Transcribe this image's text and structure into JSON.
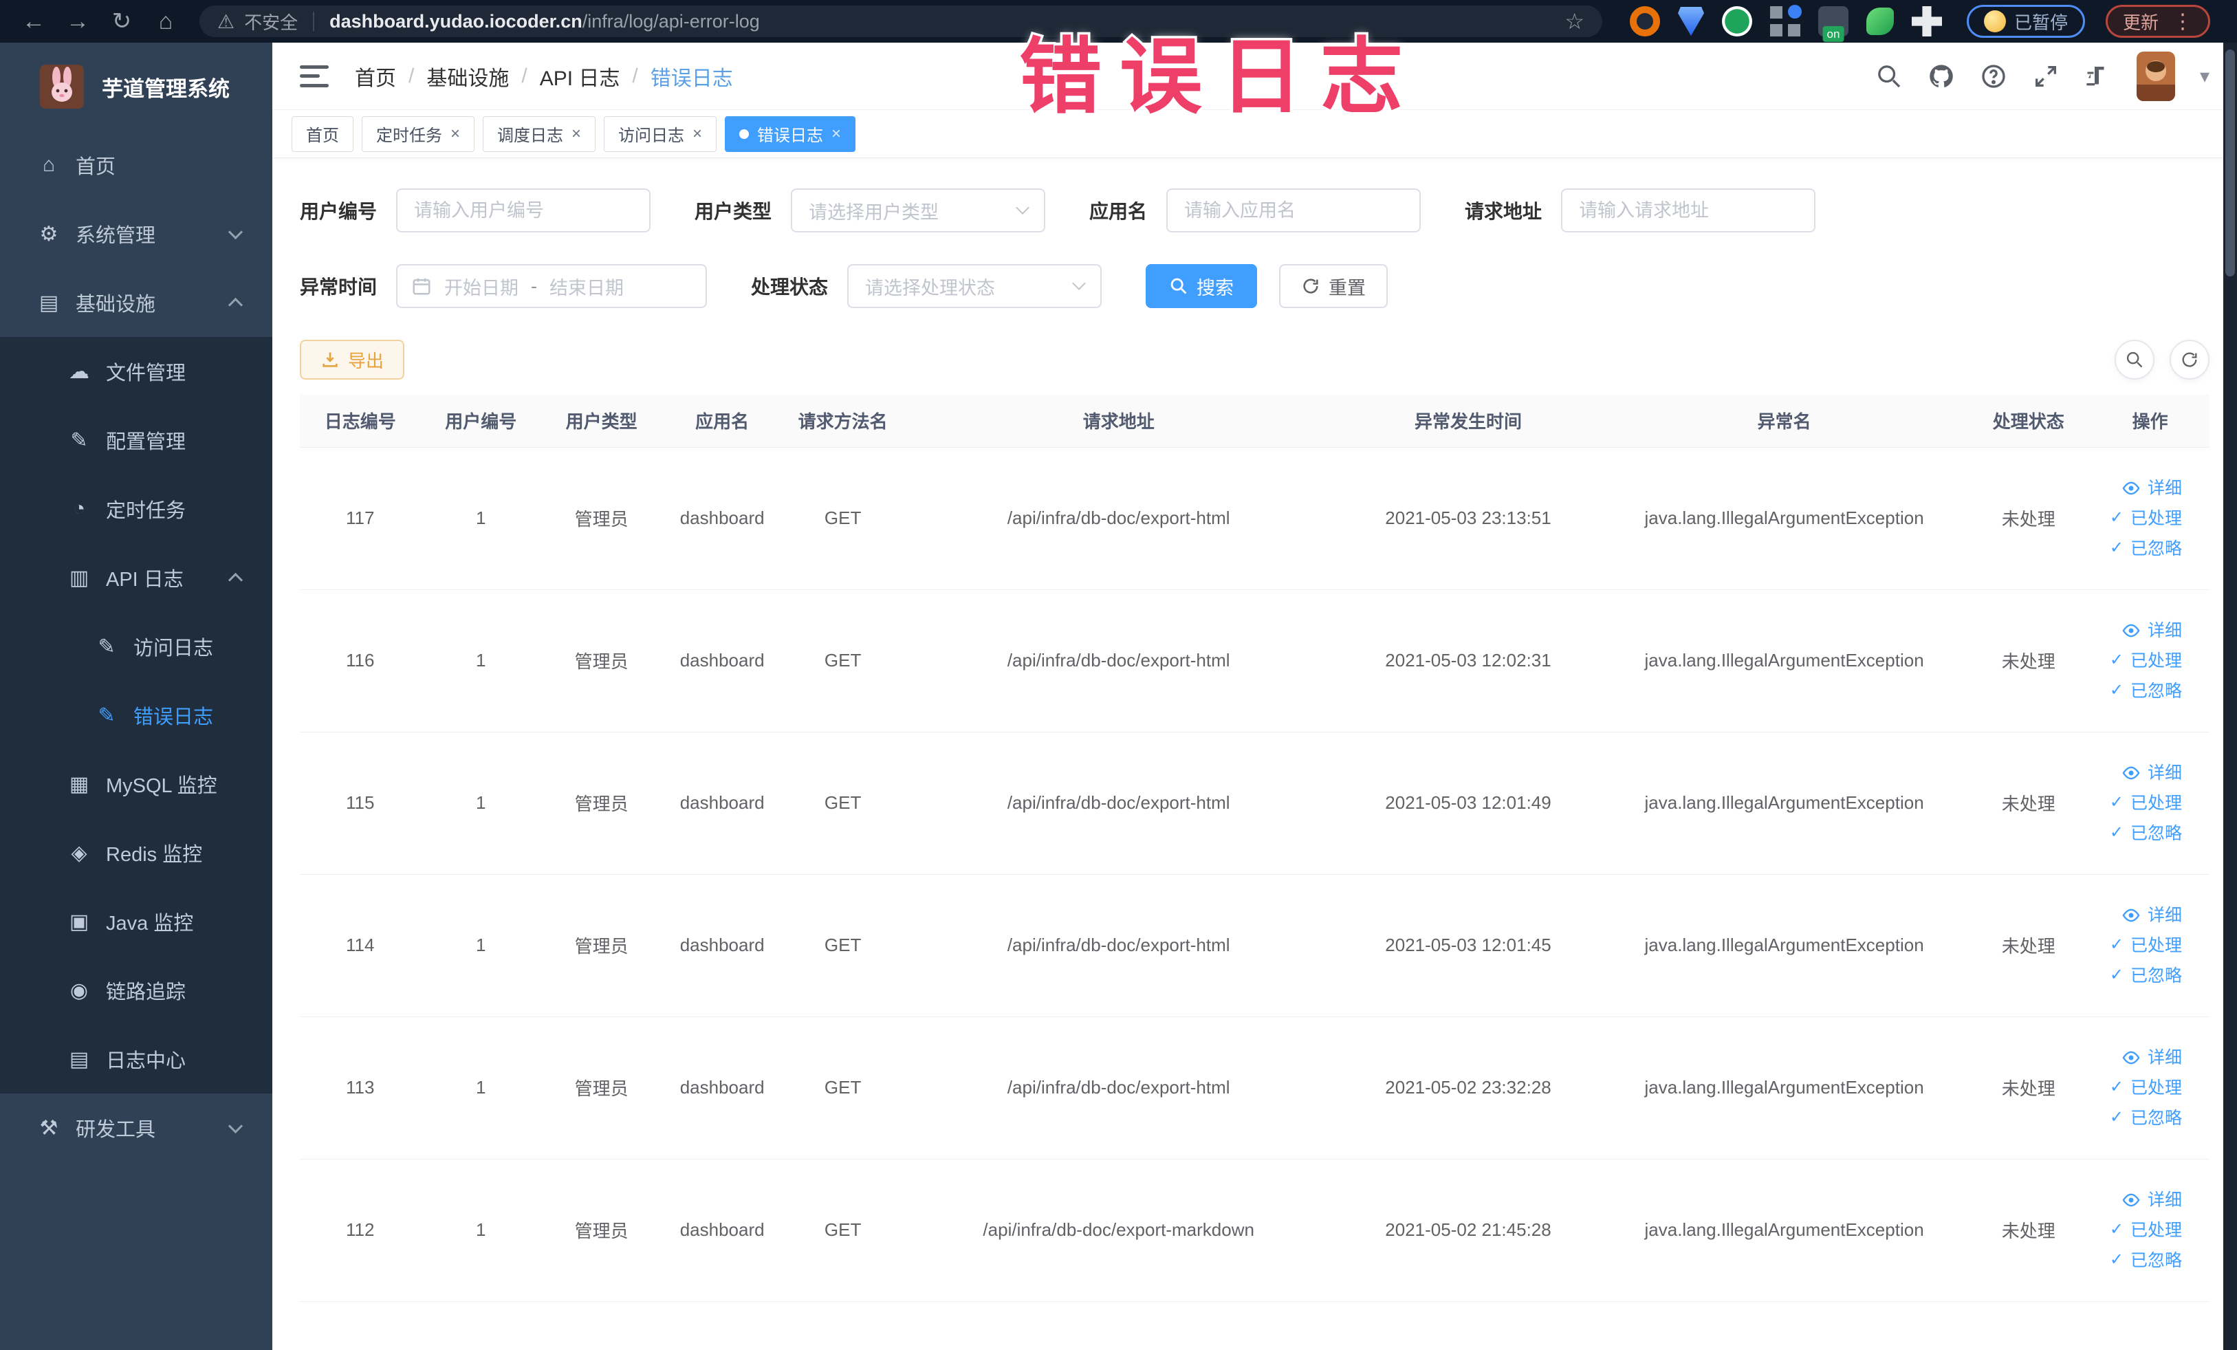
{
  "browser": {
    "security_text": "不安全",
    "url_host": "dashboard.yudao.iocoder.cn",
    "url_path": "/infra/log/api-error-log",
    "on_badge": "on",
    "paused_label": "已暂停",
    "update_label": "更新"
  },
  "overlay": {
    "text": "错误日志"
  },
  "sidebar": {
    "title": "芋道管理系统",
    "items": [
      {
        "label": "首页",
        "icon": "home",
        "level": 1
      },
      {
        "label": "系统管理",
        "icon": "gear",
        "level": 1,
        "chevron": "down"
      },
      {
        "label": "基础设施",
        "icon": "infra",
        "level": 1,
        "chevron": "up"
      },
      {
        "label": "文件管理",
        "icon": "cloud",
        "level": 2,
        "sub": true
      },
      {
        "label": "配置管理",
        "icon": "edit",
        "level": 2,
        "sub": true
      },
      {
        "label": "定时任务",
        "icon": "clock",
        "level": 2,
        "sub": true
      },
      {
        "label": "API 日志",
        "icon": "apilog",
        "level": 2,
        "sub": true,
        "chevron": "up"
      },
      {
        "label": "访问日志",
        "icon": "doc",
        "level": 3,
        "sub": true
      },
      {
        "label": "错误日志",
        "icon": "doc",
        "level": 3,
        "sub": true,
        "active": true
      },
      {
        "label": "MySQL 监控",
        "icon": "db",
        "level": 2,
        "sub": true
      },
      {
        "label": "Redis 监控",
        "icon": "redis",
        "level": 2,
        "sub": true
      },
      {
        "label": "Java 监控",
        "icon": "java",
        "level": 2,
        "sub": true
      },
      {
        "label": "链路追踪",
        "icon": "eye",
        "level": 2,
        "sub": true
      },
      {
        "label": "日志中心",
        "icon": "logcenter",
        "level": 2,
        "sub": true
      },
      {
        "label": "研发工具",
        "icon": "tools",
        "level": 1,
        "chevron": "down"
      }
    ]
  },
  "header": {
    "breadcrumb": [
      "首页",
      "基础设施",
      "API 日志",
      "错误日志"
    ]
  },
  "tabs": [
    {
      "label": "首页",
      "closable": false,
      "active": false
    },
    {
      "label": "定时任务",
      "closable": true,
      "active": false
    },
    {
      "label": "调度日志",
      "closable": true,
      "active": false
    },
    {
      "label": "访问日志",
      "closable": true,
      "active": false
    },
    {
      "label": "错误日志",
      "closable": true,
      "active": true
    }
  ],
  "filters": {
    "user_id_label": "用户编号",
    "user_id_placeholder": "请输入用户编号",
    "user_type_label": "用户类型",
    "user_type_placeholder": "请选择用户类型",
    "app_name_label": "应用名",
    "app_name_placeholder": "请输入应用名",
    "request_url_label": "请求地址",
    "request_url_placeholder": "请输入请求地址",
    "exception_time_label": "异常时间",
    "date_start_placeholder": "开始日期",
    "date_separator": "-",
    "date_end_placeholder": "结束日期",
    "process_status_label": "处理状态",
    "process_status_placeholder": "请选择处理状态",
    "search_label": "搜索",
    "reset_label": "重置"
  },
  "toolbar": {
    "export_label": "导出"
  },
  "table": {
    "columns": [
      "日志编号",
      "用户编号",
      "用户类型",
      "应用名",
      "请求方法名",
      "请求地址",
      "异常发生时间",
      "异常名",
      "处理状态",
      "操作"
    ],
    "actions": [
      "详细",
      "已处理",
      "已忽略"
    ],
    "rows": [
      {
        "log_id": "117",
        "user_id": "1",
        "user_type": "管理员",
        "app_name": "dashboard",
        "method": "GET",
        "url": "/api/infra/db-doc/export-html",
        "time": "2021-05-03 23:13:51",
        "exception": "java.lang.IllegalArgumentException",
        "status": "未处理"
      },
      {
        "log_id": "116",
        "user_id": "1",
        "user_type": "管理员",
        "app_name": "dashboard",
        "method": "GET",
        "url": "/api/infra/db-doc/export-html",
        "time": "2021-05-03 12:02:31",
        "exception": "java.lang.IllegalArgumentException",
        "status": "未处理"
      },
      {
        "log_id": "115",
        "user_id": "1",
        "user_type": "管理员",
        "app_name": "dashboard",
        "method": "GET",
        "url": "/api/infra/db-doc/export-html",
        "time": "2021-05-03 12:01:49",
        "exception": "java.lang.IllegalArgumentException",
        "status": "未处理"
      },
      {
        "log_id": "114",
        "user_id": "1",
        "user_type": "管理员",
        "app_name": "dashboard",
        "method": "GET",
        "url": "/api/infra/db-doc/export-html",
        "time": "2021-05-03 12:01:45",
        "exception": "java.lang.IllegalArgumentException",
        "status": "未处理"
      },
      {
        "log_id": "113",
        "user_id": "1",
        "user_type": "管理员",
        "app_name": "dashboard",
        "method": "GET",
        "url": "/api/infra/db-doc/export-html",
        "time": "2021-05-02 23:32:28",
        "exception": "java.lang.IllegalArgumentException",
        "status": "未处理"
      },
      {
        "log_id": "112",
        "user_id": "1",
        "user_type": "管理员",
        "app_name": "dashboard",
        "method": "GET",
        "url": "/api/infra/db-doc/export-markdown",
        "time": "2021-05-02 21:45:28",
        "exception": "java.lang.IllegalArgumentException",
        "status": "未处理"
      }
    ],
    "status_colors": {
      "accent": "#409eff",
      "warning": "#e6a23c"
    }
  }
}
